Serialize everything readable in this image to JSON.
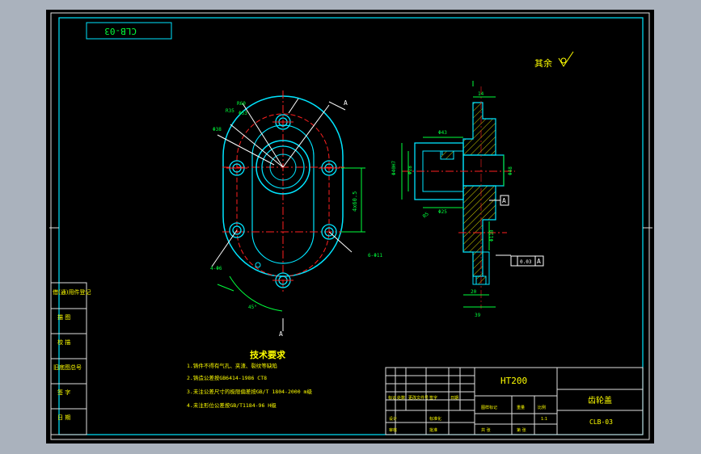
{
  "drawing": {
    "code_box": "CLB-03",
    "surface_finish_note": "其余",
    "tech_req_title": "技术要求",
    "tech_req_items": [
      "1.铸件不得有气孔、夹渣、裂纹等缺陷",
      "2.铸造公差按GB6414-1986 CT8",
      "3.未注公差尺寸的极限偏差按GB/T 1804-2000 m级",
      "4.未注形位公差按GB/T1184-96 H级"
    ],
    "material": "HT200",
    "part_name": "齿轮盖",
    "part_code": "CLB-03",
    "datum_label": "A",
    "left_column": [
      "借(通)用件登记",
      "描 图",
      "校 描",
      "旧底图总号",
      "签 字",
      "日 期"
    ]
  },
  "colors": {
    "background": "#000000",
    "frame": "#ffffff",
    "outline": "#00e5ff",
    "center": "#ff2020",
    "dimension": "#00ff3c",
    "text": "#ffff00",
    "hatch": "#ffff00",
    "annotation": "#ffffff"
  }
}
